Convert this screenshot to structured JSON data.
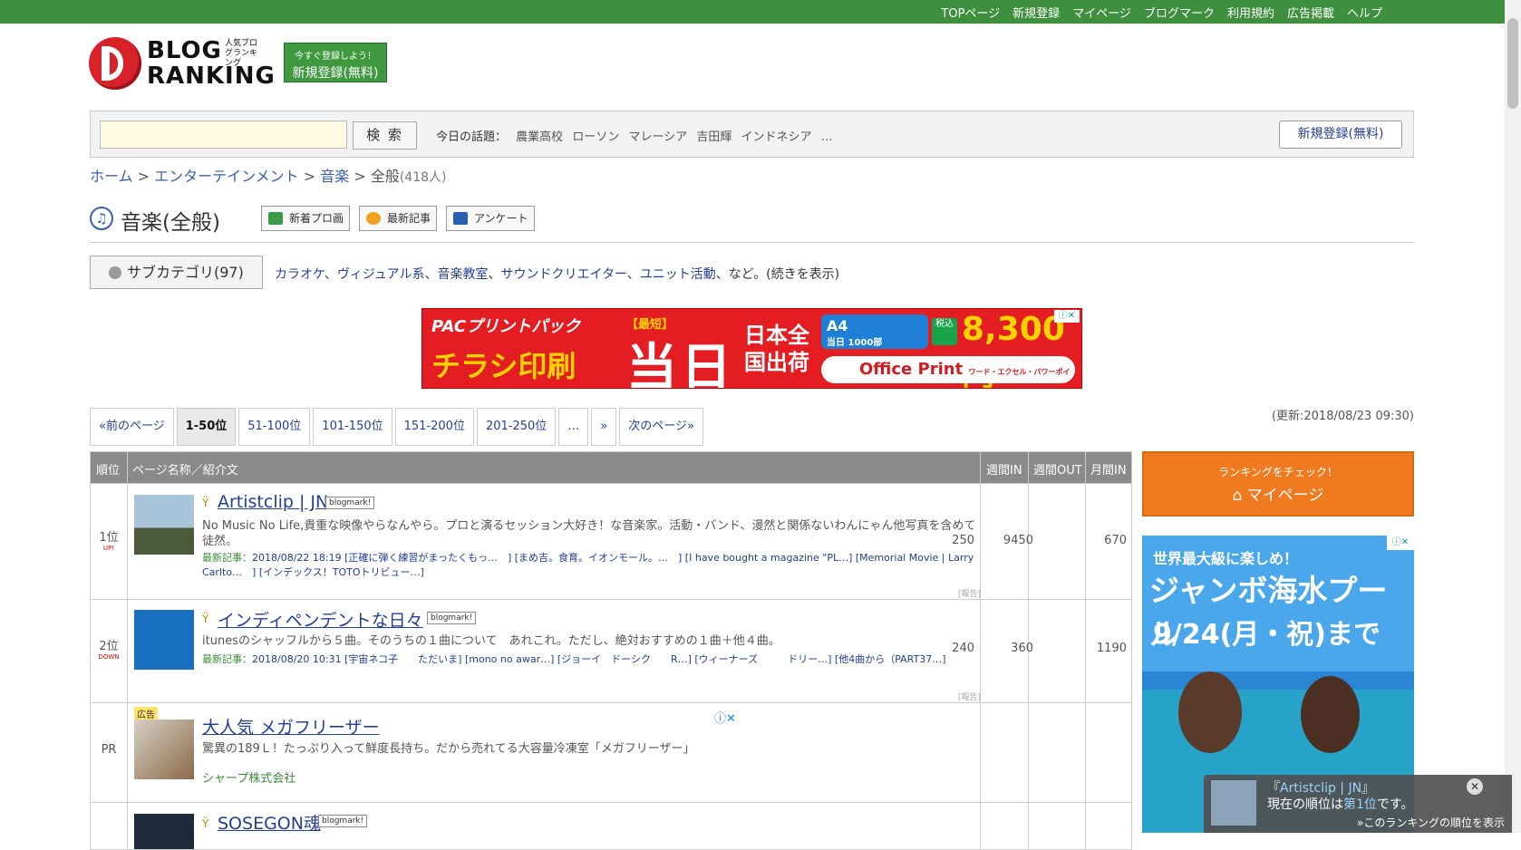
{
  "topnav": [
    "TOPページ",
    "新規登録",
    "マイページ",
    "ブログマーク",
    "利用規約",
    "広告掲載",
    "ヘルプ"
  ],
  "logo": {
    "line1": "BLOG",
    "line2": "RANKING",
    "jp": "人気ブログランキング"
  },
  "reg_badge": {
    "small": "今すぐ登録しよう！",
    "big": "新規登録(無料)"
  },
  "search": {
    "button": "検 索",
    "topics_label": "今日の話題：",
    "topics": [
      "農業高校",
      "ローソン",
      "マレーシア",
      "吉田輝",
      "インドネシア",
      "…"
    ],
    "register": "新規登録(無料)"
  },
  "breadcrumb": {
    "home": "ホーム",
    "sep": " > ",
    "cat": "エンターテインメント",
    "sub": "音楽",
    "current": "全般",
    "count": "(418人)"
  },
  "page_title": "音楽(全般)",
  "title_buttons": [
    "新着プロ画",
    "最新記事",
    "アンケート"
  ],
  "subcat": {
    "button": "サブカテゴリ(97)",
    "links": [
      "カラオケ",
      "ヴィジュアル系",
      "音楽教室",
      "サウンドクリエイター",
      "ユニット活動"
    ],
    "suffix": "、など。(続きを表示)"
  },
  "ad": {
    "brand": "PACプリントパック",
    "main": "チラシ印刷",
    "kind": "【最短】",
    "today": "当日",
    "ship": "日本全国出荷",
    "box": "A4",
    "box_sub": "当日 1000部",
    "tax": "税込",
    "price": "8,300円",
    "office": "Office Print",
    "office_sub": "ワード・エクセル・パワーポイント パブリッシャーなども印刷OK!"
  },
  "pager": [
    "«前のページ",
    "1-50位",
    "51-100位",
    "101-150位",
    "151-200位",
    "201-250位",
    "…",
    "»",
    "次のページ»"
  ],
  "updated": "(更新:2018/08/23 09:30)",
  "table": {
    "headers": {
      "rank": "順位",
      "name": "ページ名称／紹介文",
      "win": "週間IN",
      "wout": "週間OUT",
      "min": "月間IN"
    },
    "rows": [
      {
        "rank": "1位",
        "trend": "UP!",
        "title": "Artistclip | JN",
        "bm": "blogmark!",
        "desc": "No Music No Life,貴重な映像やらなんやら。プロと演るセッション大好き！な音楽家。活動・バンド、漫然と関係ないわんにゃん他写真を含めて徒然。",
        "meta_label": "最新記事：",
        "meta": "2018/08/22 18:19 [正確に弾く練習がまったくもっ…　] [まめ吉。食育。イオンモール。…　] [I have bought a magazine \"PL…] [Memorial Movie | Larry Carlto…　] [インデックス！TOTOトリビュー…]",
        "report": "[報告]",
        "win": "250",
        "wout": "9450",
        "min": "670"
      },
      {
        "rank": "2位",
        "trend": "DOWN",
        "title": "インディペンデントな日々",
        "bm": "blogmark!",
        "desc": "itunesのシャッフルから５曲。そのうちの１曲について　あれこれ。ただし、絶対おすすめの１曲＋他４曲。",
        "meta_label": "最新記事：",
        "meta": "2018/08/20 10:31 [宇宙ネコ子　　ただいま] [mono no awar…] [ジョーイ　ドーシク　　R…] [ウィーナーズ　　　ドリー…] [他4曲から（PART37…]",
        "report": "[報告]",
        "win": "240",
        "wout": "360",
        "min": "1190"
      }
    ],
    "pr": {
      "rank": "PR",
      "tag": "広告",
      "title": "大人気 メガフリーザー",
      "desc": "驚異の189Ｌ！たっぷり入って鮮度長持ち。だから売れてる大容量冷凍室「メガフリーザー」",
      "company": "シャープ株式会社"
    },
    "row4": {
      "title": "SOSEGON魂",
      "bm": "blogmark!"
    }
  },
  "sidebar": {
    "small": "ランキングをチェック！",
    "big": "マイページ"
  },
  "pool_ad": {
    "t1": "世界最大級に楽しめ！",
    "t2": "ジャンボ海水プール",
    "t3": "9/24(月・祝)まで"
  },
  "toast": {
    "name": "Artistclip | JN",
    "pre": "『",
    "post": "』",
    "rank_pre": "現在の順位は",
    "rank": "第1位",
    "rank_post": "です。",
    "link": "»このランキングの順位を表示"
  }
}
